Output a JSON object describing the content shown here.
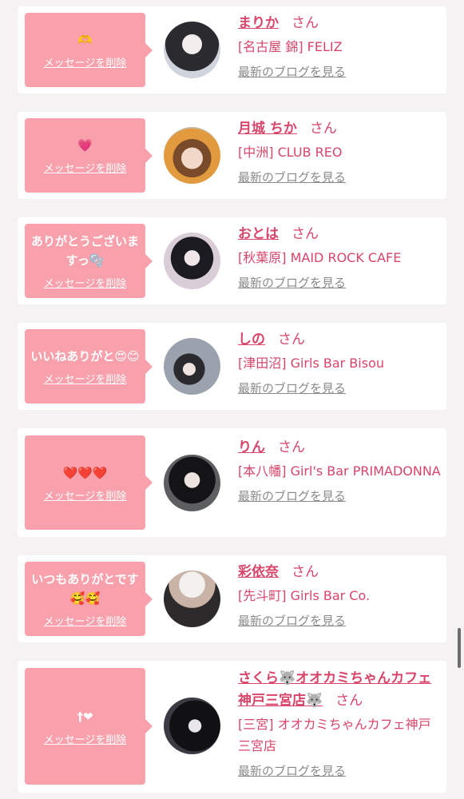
{
  "delete_label": "メッセージを削除",
  "blog_label": "最新のブログを見る",
  "san_label": "さん",
  "items": [
    {
      "message": "🫶",
      "name": "まりか",
      "shop": "[名古屋 錦] FELIZ"
    },
    {
      "message": "💗",
      "name": "月城 ちか",
      "shop": "[中洲] CLUB REO"
    },
    {
      "message": "ありがとうございますっ🫧",
      "name": "おとは",
      "shop": "[秋葉原] MAID ROCK CAFE"
    },
    {
      "message": "いいねありがと😍😊",
      "name": "しの",
      "shop": "[津田沼] Girls Bar Bisou"
    },
    {
      "message": "❤️❤️❤️",
      "name": "りん",
      "shop": "[本八幡] Girl's Bar PRIMADONNA"
    },
    {
      "message": "いつもありがとです🥰🥰",
      "name": "彩依奈",
      "shop": "[先斗町] Girls Bar Co."
    },
    {
      "message": "†❤",
      "name": "さくら🐺オオカミちゃんカフェ神戸三宮店🐺",
      "shop": "[三宮] オオカミちゃんカフェ神戸三宮店"
    }
  ],
  "colors": {
    "accent": "#d8456b",
    "bubble": "#f8a1ad",
    "background": "#f4f2f3"
  }
}
